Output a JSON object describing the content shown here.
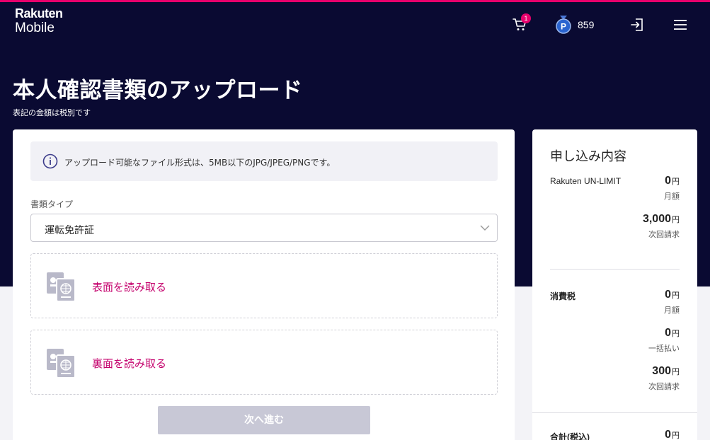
{
  "header": {
    "logo_line1": "Rakuten",
    "logo_line2": "Mobile",
    "cart_count": "1",
    "points": "859",
    "icons": [
      "cart-icon",
      "points-medal-icon",
      "login-icon",
      "menu-icon"
    ]
  },
  "page": {
    "title": "本人確認書類のアップロード",
    "subtitle": "表記の金額は税別です"
  },
  "form": {
    "info_text": "アップロード可能なファイル形式は、5MB以下のJPG/JPEG/PNGです。",
    "doc_type_label": "書類タイプ",
    "doc_type_value": "運転免許証",
    "front_label": "表面を読み取る",
    "back_label": "裏面を読み取る",
    "next_label": "次へ進む"
  },
  "summary": {
    "title": "申し込み内容",
    "plan_name": "Rakuten UN-LIMIT",
    "plan_monthly": "0",
    "plan_monthly_note": "月額",
    "plan_next": "3,000",
    "plan_next_note": "次回請求",
    "tax_label": "消費税",
    "tax_monthly": "0",
    "tax_monthly_note": "月額",
    "tax_lump": "0",
    "tax_lump_note": "一括払い",
    "tax_next": "300",
    "tax_next_note": "次回請求",
    "total_label": "合計(税込)",
    "total_value": "0",
    "yen": "円"
  },
  "colors": {
    "header_bg": "#0a0a32",
    "accent": "#e8006c",
    "link": "#c4006c",
    "disabled_button": "#c8c8d6"
  }
}
